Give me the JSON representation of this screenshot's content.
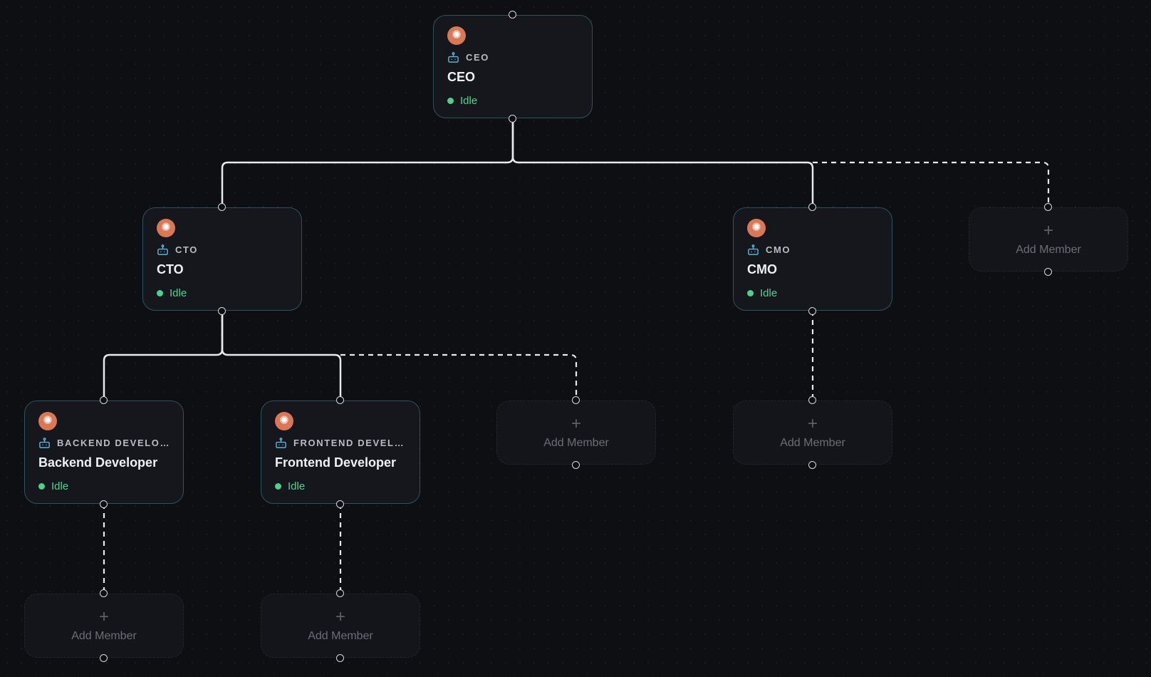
{
  "org_chart": {
    "agents": [
      {
        "id": "ceo",
        "role_tag": "CEO",
        "name": "CEO",
        "status": "Idle"
      },
      {
        "id": "cto",
        "role_tag": "CTO",
        "name": "CTO",
        "status": "Idle"
      },
      {
        "id": "cmo",
        "role_tag": "CMO",
        "name": "CMO",
        "status": "Idle"
      },
      {
        "id": "backend",
        "role_tag": "BACKEND DEVELO…",
        "name": "Backend Developer",
        "status": "Idle"
      },
      {
        "id": "frontend",
        "role_tag": "FRONTEND DEVEL…",
        "name": "Frontend Developer",
        "status": "Idle"
      }
    ],
    "add_member": {
      "plus": "+",
      "label": "Add Member"
    },
    "agent_logo_icon": "claude-sunburst-icon",
    "role_icon": "robot-icon",
    "colors": {
      "background": "#0e0f13",
      "card": "#15171d",
      "card_border": "#2d5361",
      "logo": "#d97757",
      "status_idle": "#4ed08b",
      "edge": "#e8e9ec"
    }
  }
}
